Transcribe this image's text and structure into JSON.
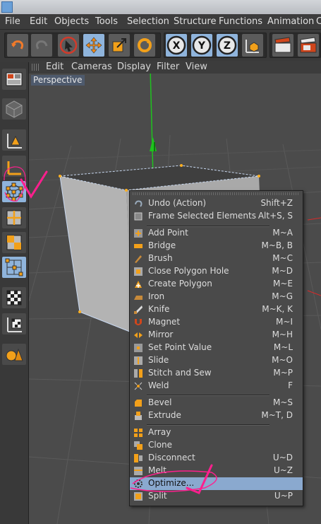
{
  "menubar": {
    "items": [
      "File",
      "Edit",
      "Objects",
      "Tools",
      "Selection",
      "Structure",
      "Functions",
      "Animation",
      "C"
    ]
  },
  "viewport": {
    "menu": [
      "Edit",
      "Cameras",
      "Display",
      "Filter",
      "View"
    ],
    "label": "Perspective"
  },
  "toolbar": {
    "axis_x": "X",
    "axis_y": "Y",
    "axis_z": "Z"
  },
  "context_menu": {
    "highlighted": "Optimize...",
    "items": [
      {
        "label": "Undo (Action)",
        "shortcut": "Shift+Z",
        "icon": "undo-icon"
      },
      {
        "label": "Frame Selected Elements",
        "shortcut": "Alt+S, S",
        "icon": "frame-icon"
      },
      {
        "label": "Add Point",
        "shortcut": "M~A",
        "icon": "add-point-icon"
      },
      {
        "label": "Bridge",
        "shortcut": "M~B, B",
        "icon": "bridge-icon"
      },
      {
        "label": "Brush",
        "shortcut": "M~C",
        "icon": "brush-icon"
      },
      {
        "label": "Close Polygon Hole",
        "shortcut": "M~D",
        "icon": "close-hole-icon"
      },
      {
        "label": "Create Polygon",
        "shortcut": "M~E",
        "icon": "create-polygon-icon"
      },
      {
        "label": "Iron",
        "shortcut": "M~G",
        "icon": "iron-icon"
      },
      {
        "label": "Knife",
        "shortcut": "M~K, K",
        "icon": "knife-icon"
      },
      {
        "label": "Magnet",
        "shortcut": "M~I",
        "icon": "magnet-icon"
      },
      {
        "label": "Mirror",
        "shortcut": "M~H",
        "icon": "mirror-icon"
      },
      {
        "label": "Set Point Value",
        "shortcut": "M~L",
        "icon": "set-point-icon"
      },
      {
        "label": "Slide",
        "shortcut": "M~O",
        "icon": "slide-icon"
      },
      {
        "label": "Stitch and Sew",
        "shortcut": "M~P",
        "icon": "stitch-icon"
      },
      {
        "label": "Weld",
        "shortcut": "F",
        "icon": "weld-icon"
      },
      {
        "label": "Bevel",
        "shortcut": "M~S",
        "icon": "bevel-icon"
      },
      {
        "label": "Extrude",
        "shortcut": "M~T, D",
        "icon": "extrude-icon"
      },
      {
        "label": "Array",
        "shortcut": "",
        "icon": "array-icon"
      },
      {
        "label": "Clone",
        "shortcut": "",
        "icon": "clone-icon"
      },
      {
        "label": "Disconnect",
        "shortcut": "U~D",
        "icon": "disconnect-icon"
      },
      {
        "label": "Melt",
        "shortcut": "U~Z",
        "icon": "melt-icon"
      },
      {
        "label": "Optimize...",
        "shortcut": "",
        "icon": "optimize-icon"
      },
      {
        "label": "Split",
        "shortcut": "U~P",
        "icon": "split-icon"
      }
    ]
  },
  "colors": {
    "highlight": "#8aa9cf",
    "active_tool": "#8fb4dc",
    "annotation": "#ff1f8e",
    "axis_y": "#1fc21f"
  }
}
